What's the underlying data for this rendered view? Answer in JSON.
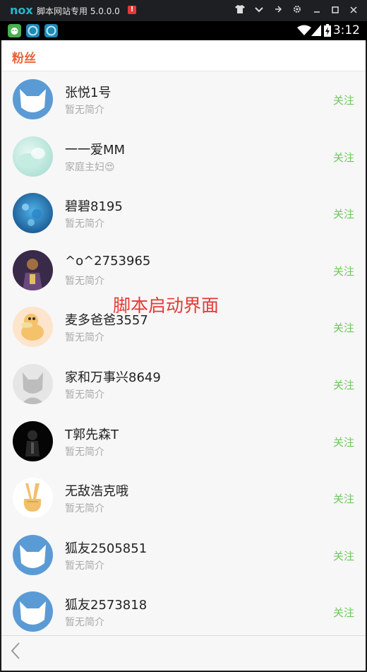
{
  "window": {
    "logo": "nox",
    "title": "脚本网站专用 5.0.0.0",
    "warn": "!",
    "controls": [
      "shirt-icon",
      "chevron-down-icon",
      "pin-icon",
      "gear-icon",
      "minimize-icon",
      "maximize-icon",
      "close-icon"
    ]
  },
  "statusbar": {
    "time": "3:12"
  },
  "header": {
    "title": "粉丝"
  },
  "follow_label": "关注",
  "followers": [
    {
      "name": "张悦1号",
      "bio": "暂无简介",
      "avatar": "fox-default"
    },
    {
      "name": "一一爱MM",
      "bio": "家庭主妇😍",
      "avatar": "mint-photo"
    },
    {
      "name": "碧碧8195",
      "bio": "暂无简介",
      "avatar": "ocean-photo"
    },
    {
      "name": "^o^2753965",
      "bio": "暂无简介",
      "avatar": "dark-photo"
    },
    {
      "name": "麦多爸爸3557",
      "bio": "暂无简介",
      "avatar": "duck-cartoon"
    },
    {
      "name": "家和万事兴8649",
      "bio": "暂无简介",
      "avatar": "gray-fox"
    },
    {
      "name": "T郭先森T",
      "bio": "暂无简介",
      "avatar": "black-photo"
    },
    {
      "name": "无敌浩克哦",
      "bio": "暂无简介",
      "avatar": "victory-hand"
    },
    {
      "name": "狐友2505851",
      "bio": "暂无简介",
      "avatar": "fox-default"
    },
    {
      "name": "狐友2573818",
      "bio": "暂无简介",
      "avatar": "fox-default"
    }
  ],
  "overlay": "脚本启动界面",
  "colors": {
    "accent": "#e8623c",
    "follow": "#6ec85c",
    "overlay": "#e53935"
  }
}
